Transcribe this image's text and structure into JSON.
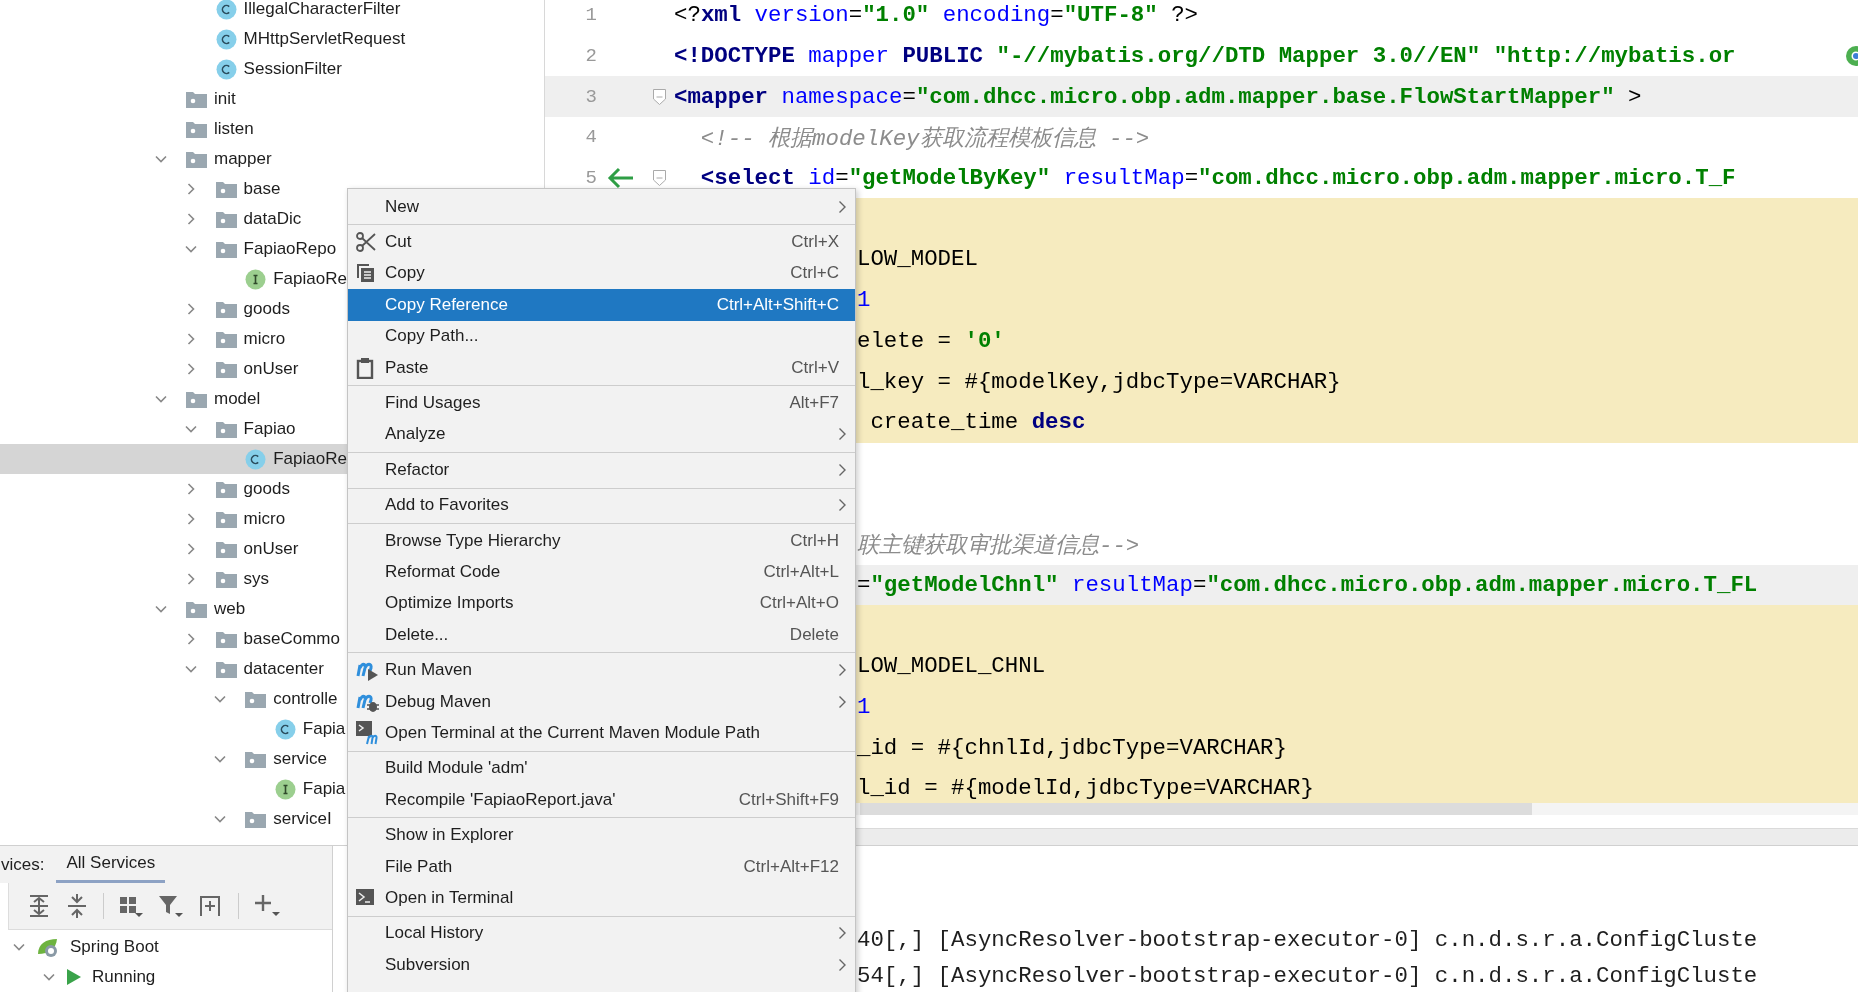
{
  "project_tree": {
    "leading_items": [
      {
        "label": "IllegalCharacterFilter",
        "kind": "class",
        "selected": false
      },
      {
        "label": "MHttpServletRequest",
        "kind": "class",
        "selected": false
      },
      {
        "label": "SessionFilter",
        "kind": "class",
        "selected": false
      }
    ],
    "items": [
      {
        "label": "init",
        "kind": "folder",
        "selected": false
      },
      {
        "label": "listen",
        "kind": "folder",
        "selected": false
      },
      {
        "label": "mapper",
        "kind": "folder",
        "expanded": true,
        "selected": false,
        "children": [
          {
            "label": "base",
            "kind": "folder",
            "expanded": false,
            "selected": false
          },
          {
            "label": "dataDic",
            "kind": "folder",
            "expanded": false,
            "selected": false
          },
          {
            "label": "FapiaoRepo",
            "kind": "folder",
            "expanded": true,
            "selected": false,
            "children": [
              {
                "label": "FapiaoRe",
                "kind": "interface",
                "selected": false
              }
            ]
          },
          {
            "label": "goods",
            "kind": "folder",
            "expanded": false,
            "selected": false
          },
          {
            "label": "micro",
            "kind": "folder",
            "expanded": false,
            "selected": false
          },
          {
            "label": "onUser",
            "kind": "folder",
            "expanded": false,
            "selected": false
          }
        ]
      },
      {
        "label": "model",
        "kind": "folder",
        "expanded": true,
        "selected": false,
        "children": [
          {
            "label": "Fapiao",
            "kind": "folder",
            "expanded": true,
            "selected": false,
            "children": [
              {
                "label": "FapiaoRe",
                "kind": "class",
                "selected": true
              }
            ]
          },
          {
            "label": "goods",
            "kind": "folder",
            "expanded": false,
            "selected": false
          },
          {
            "label": "micro",
            "kind": "folder",
            "expanded": false,
            "selected": false
          },
          {
            "label": "onUser",
            "kind": "folder",
            "expanded": false,
            "selected": false
          },
          {
            "label": "sys",
            "kind": "folder",
            "expanded": false,
            "selected": false
          }
        ]
      },
      {
        "label": "web",
        "kind": "folder",
        "expanded": true,
        "selected": false,
        "children": [
          {
            "label": "baseCommo",
            "kind": "folder",
            "expanded": false,
            "selected": false
          },
          {
            "label": "datacenter",
            "kind": "folder",
            "expanded": true,
            "selected": false,
            "children": [
              {
                "label": "controlle",
                "kind": "folder",
                "expanded": true,
                "selected": false,
                "children": [
                  {
                    "label": "Fapia",
                    "kind": "class",
                    "selected": false
                  }
                ]
              },
              {
                "label": "service",
                "kind": "folder",
                "expanded": true,
                "selected": false,
                "children": [
                  {
                    "label": "Fapia",
                    "kind": "interface",
                    "selected": false
                  }
                ]
              },
              {
                "label": "serviceI",
                "kind": "folder",
                "expanded": true,
                "selected": false
              }
            ]
          }
        ]
      }
    ]
  },
  "editor": {
    "lines": [
      {
        "number": "1",
        "tag_highlight": false,
        "injected": false,
        "segments": [
          {
            "kind": "plain",
            "text": "<?"
          },
          {
            "kind": "tag",
            "text": "xml"
          },
          {
            "kind": "attr",
            "text": " version"
          },
          {
            "kind": "plain",
            "text": "="
          },
          {
            "kind": "value",
            "text": "\"1.0\""
          },
          {
            "kind": "attr",
            "text": " encoding"
          },
          {
            "kind": "plain",
            "text": "="
          },
          {
            "kind": "value",
            "text": "\"UTF-8\""
          },
          {
            "kind": "plain",
            "text": " ?>"
          }
        ]
      },
      {
        "number": "2",
        "tag_highlight": false,
        "injected": false,
        "segments": [
          {
            "kind": "tag",
            "text": "<!DOCTYPE"
          },
          {
            "kind": "attr",
            "text": " mapper"
          },
          {
            "kind": "tag",
            "text": " PUBLIC"
          },
          {
            "kind": "value",
            "text": " \"-//mybatis.org//DTD Mapper 3.0//EN\""
          },
          {
            "kind": "value",
            "text": " \"http://mybatis.or"
          }
        ]
      },
      {
        "number": "3",
        "tag_highlight": true,
        "injected": false,
        "foldable": true,
        "segments": [
          {
            "kind": "tag",
            "text": "<mapper"
          },
          {
            "kind": "attr",
            "text": " namespace"
          },
          {
            "kind": "plain",
            "text": "="
          },
          {
            "kind": "value",
            "text": "\"com.dhcc.micro.obp.adm.mapper.base.FlowStartMapper\""
          },
          {
            "kind": "plain",
            "text": " >"
          }
        ]
      },
      {
        "number": "4",
        "tag_highlight": false,
        "injected": false,
        "segments": [
          {
            "kind": "comment",
            "text": "  <!-- 根据modelKey获取流程模板信息 -->"
          }
        ]
      },
      {
        "number": "5",
        "tag_highlight": false,
        "injected": false,
        "foldable": true,
        "implemented": true,
        "segments": [
          {
            "kind": "tag",
            "text": "  <select"
          },
          {
            "kind": "attr",
            "text": " id"
          },
          {
            "kind": "plain",
            "text": "="
          },
          {
            "kind": "value",
            "text": "\"getModelByKey\""
          },
          {
            "kind": "attr",
            "text": " resultMap"
          },
          {
            "kind": "plain",
            "text": "="
          },
          {
            "kind": "value",
            "text": "\"com.dhcc.micro.obp.adm.mapper.micro.T_F"
          }
        ]
      },
      {
        "tag_highlight": false,
        "injected": true
      },
      {
        "tag_highlight": false,
        "injected": true,
        "segments": [
          {
            "kind": "plain",
            "text": "LOW_MODEL"
          }
        ]
      },
      {
        "tag_highlight": false,
        "injected": true,
        "segments": [
          {
            "kind": "number",
            "text": "1"
          }
        ]
      },
      {
        "tag_highlight": false,
        "injected": true,
        "segments": [
          {
            "kind": "plain",
            "text": "elete = "
          },
          {
            "kind": "value",
            "text": "'0'"
          }
        ]
      },
      {
        "tag_highlight": false,
        "injected": true,
        "segments": [
          {
            "kind": "plain",
            "text": "l_key = #{modelKey,jdbcType=VARCHAR}"
          }
        ]
      },
      {
        "tag_highlight": false,
        "injected": true,
        "segments": [
          {
            "kind": "plain",
            "text": " create_time "
          },
          {
            "kind": "tag",
            "text": "desc"
          }
        ]
      },
      {
        "tag_highlight": false,
        "injected": false
      },
      {
        "tag_highlight": false,
        "injected": false
      },
      {
        "tag_highlight": false,
        "injected": false,
        "segments": [
          {
            "kind": "comment",
            "text": "联主键获取审批渠道信息-->"
          }
        ]
      },
      {
        "tag_highlight": true,
        "injected": false,
        "segments": [
          {
            "kind": "plain",
            "text": "="
          },
          {
            "kind": "value",
            "text": "\"getModelChnl\""
          },
          {
            "kind": "attr",
            "text": " resultMap"
          },
          {
            "kind": "plain",
            "text": "="
          },
          {
            "kind": "value",
            "text": "\"com.dhcc.micro.obp.adm.mapper.micro.T_FL"
          }
        ]
      },
      {
        "tag_highlight": false,
        "injected": true
      },
      {
        "tag_highlight": false,
        "injected": true,
        "segments": [
          {
            "kind": "plain",
            "text": "LOW_MODEL_CHNL"
          }
        ]
      },
      {
        "tag_highlight": false,
        "injected": true,
        "segments": [
          {
            "kind": "number",
            "text": "1"
          }
        ]
      },
      {
        "tag_highlight": false,
        "injected": true,
        "segments": [
          {
            "kind": "plain",
            "text": "_id = #{chnlId,jdbcType=VARCHAR}"
          }
        ]
      },
      {
        "tag_highlight": false,
        "injected": true,
        "segments": [
          {
            "kind": "plain",
            "text": "l_id = #{modelId,jdbcType=VARCHAR}"
          }
        ]
      }
    ]
  },
  "services": {
    "caption": "vices:",
    "tabs": [
      {
        "label": "All Services",
        "selected": true
      }
    ],
    "tree": [
      {
        "label": "Spring Boot",
        "kind": "spring",
        "expanded": true,
        "children": [
          {
            "label": "Running",
            "kind": "running",
            "expanded": true
          }
        ]
      }
    ]
  },
  "console": {
    "lines": [
      "40[,] [AsyncResolver-bootstrap-executor-0] c.n.d.s.r.a.ConfigCluste",
      "54[,] [AsyncResolver-bootstrap-executor-0] c.n.d.s.r.a.ConfigCluste"
    ]
  },
  "context_menu": {
    "groups": [
      [
        {
          "label": "New",
          "kind": "plain",
          "submenu": true,
          "selected": false
        }
      ],
      [
        {
          "label": "Cut",
          "kind": "cut",
          "shortcut": "Ctrl+X",
          "selected": false
        },
        {
          "label": "Copy",
          "kind": "copy",
          "shortcut": "Ctrl+C",
          "selected": false
        },
        {
          "label": "Copy Reference",
          "kind": "plain",
          "shortcut": "Ctrl+Alt+Shift+C",
          "selected": true
        },
        {
          "label": "Copy Path...",
          "kind": "plain",
          "selected": false
        },
        {
          "label": "Paste",
          "kind": "paste",
          "shortcut": "Ctrl+V",
          "selected": false
        }
      ],
      [
        {
          "label": "Find Usages",
          "kind": "plain",
          "shortcut": "Alt+F7",
          "selected": false
        },
        {
          "label": "Analyze",
          "kind": "plain",
          "submenu": true,
          "selected": false
        }
      ],
      [
        {
          "label": "Refactor",
          "kind": "plain",
          "submenu": true,
          "selected": false
        }
      ],
      [
        {
          "label": "Add to Favorites",
          "kind": "plain",
          "submenu": true,
          "selected": false
        }
      ],
      [
        {
          "label": "Browse Type Hierarchy",
          "kind": "plain",
          "shortcut": "Ctrl+H",
          "selected": false
        },
        {
          "label": "Reformat Code",
          "kind": "plain",
          "shortcut": "Ctrl+Alt+L",
          "selected": false
        },
        {
          "label": "Optimize Imports",
          "kind": "plain",
          "shortcut": "Ctrl+Alt+O",
          "selected": false
        },
        {
          "label": "Delete...",
          "kind": "plain",
          "shortcut": "Delete",
          "selected": false
        }
      ],
      [
        {
          "label": "Run Maven",
          "kind": "maven-run",
          "submenu": true,
          "selected": false
        },
        {
          "label": "Debug Maven",
          "kind": "maven-debug",
          "submenu": true,
          "selected": false
        },
        {
          "label": "Open Terminal at the Current Maven Module Path",
          "kind": "maven-terminal",
          "selected": false
        }
      ],
      [
        {
          "label": "Build Module 'adm'",
          "kind": "plain",
          "selected": false
        },
        {
          "label": "Recompile 'FapiaoReport.java'",
          "kind": "plain",
          "shortcut": "Ctrl+Shift+F9",
          "selected": false
        }
      ],
      [
        {
          "label": "Show in Explorer",
          "kind": "plain",
          "selected": false
        },
        {
          "label": "File Path",
          "kind": "plain",
          "shortcut": "Ctrl+Alt+F12",
          "selected": false
        },
        {
          "label": "Open in Terminal",
          "kind": "terminal",
          "selected": false
        }
      ],
      [
        {
          "label": "Local History",
          "kind": "plain",
          "submenu": true,
          "selected": false
        },
        {
          "label": "Subversion",
          "kind": "plain",
          "submenu": true,
          "selected": false
        }
      ]
    ]
  }
}
